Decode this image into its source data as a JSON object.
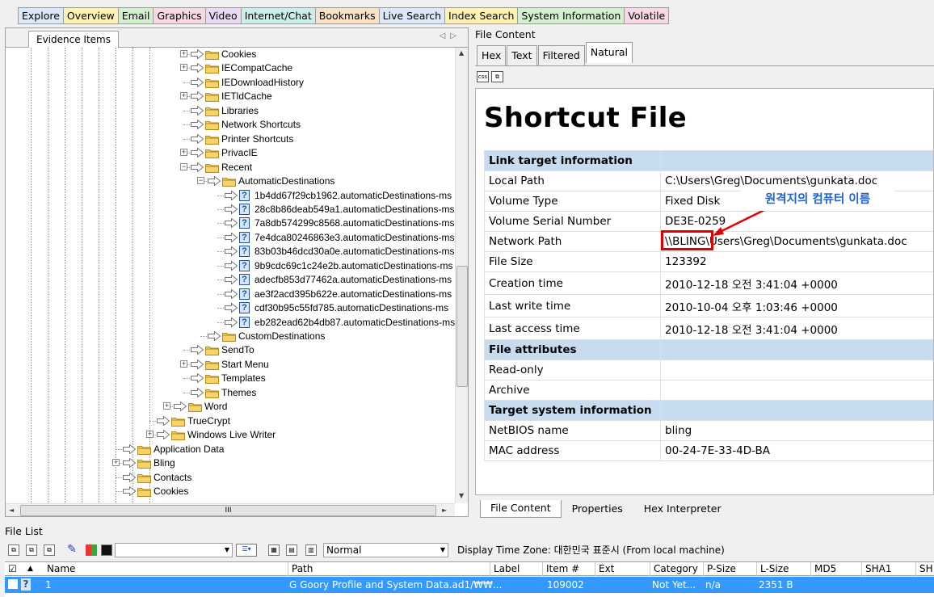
{
  "main_tabs": [
    {
      "label": "Explore",
      "bg": "#dbe8f7"
    },
    {
      "label": "Overview",
      "bg": "#fff2b3"
    },
    {
      "label": "Email",
      "bg": "#d4efd0"
    },
    {
      "label": "Graphics",
      "bg": "#f7d8e5"
    },
    {
      "label": "Video",
      "bg": "#ead9f3"
    },
    {
      "label": "Internet/Chat",
      "bg": "#cdeee8"
    },
    {
      "label": "Bookmarks",
      "bg": "#f7e1c8"
    },
    {
      "label": "Live Search",
      "bg": "#dbe8f7"
    },
    {
      "label": "Index Search",
      "bg": "#fff2b3"
    },
    {
      "label": "System Information",
      "bg": "#d4efd0"
    },
    {
      "label": "Volatile",
      "bg": "#f7d8e5"
    }
  ],
  "left_panel": {
    "tab": "Evidence Items"
  },
  "tree": [
    {
      "label": "Cookies",
      "indent": 10,
      "exp": "+",
      "kind": "folder"
    },
    {
      "label": "IECompatCache",
      "indent": 10,
      "exp": "+",
      "kind": "folder"
    },
    {
      "label": "IEDownloadHistory",
      "indent": 10,
      "exp": "",
      "kind": "folder"
    },
    {
      "label": "IETldCache",
      "indent": 10,
      "exp": "+",
      "kind": "folder"
    },
    {
      "label": "Libraries",
      "indent": 10,
      "exp": "",
      "kind": "folder"
    },
    {
      "label": "Network Shortcuts",
      "indent": 10,
      "exp": "",
      "kind": "folder"
    },
    {
      "label": "Printer Shortcuts",
      "indent": 10,
      "exp": "",
      "kind": "folder"
    },
    {
      "label": "PrivacIE",
      "indent": 10,
      "exp": "+",
      "kind": "folder"
    },
    {
      "label": "Recent",
      "indent": 10,
      "exp": "-",
      "kind": "folder"
    },
    {
      "label": "AutomaticDestinations",
      "indent": 11,
      "exp": "-",
      "kind": "folder"
    },
    {
      "label": "1b4dd67f29cb1962.automaticDestinations-ms",
      "indent": 12,
      "exp": "",
      "kind": "file"
    },
    {
      "label": "28c8b86deab549a1.automaticDestinations-ms",
      "indent": 12,
      "exp": "",
      "kind": "file"
    },
    {
      "label": "7a8db574299c8568.automaticDestinations-ms",
      "indent": 12,
      "exp": "",
      "kind": "file"
    },
    {
      "label": "7e4dca80246863e3.automaticDestinations-ms",
      "indent": 12,
      "exp": "",
      "kind": "file"
    },
    {
      "label": "83b03b46dcd30a0e.automaticDestinations-ms",
      "indent": 12,
      "exp": "",
      "kind": "file"
    },
    {
      "label": "9b9cdc69c1c24e2b.automaticDestinations-ms",
      "indent": 12,
      "exp": "",
      "kind": "file"
    },
    {
      "label": "adecfb853d77462a.automaticDestinations-ms",
      "indent": 12,
      "exp": "",
      "kind": "file"
    },
    {
      "label": "ae3f2acd395b622e.automaticDestinations-ms",
      "indent": 12,
      "exp": "",
      "kind": "file"
    },
    {
      "label": "cdf30b95c55fd785.automaticDestinations-ms",
      "indent": 12,
      "exp": "",
      "kind": "file"
    },
    {
      "label": "eb282ead62b4db87.automaticDestinations-ms",
      "indent": 12,
      "exp": "",
      "kind": "file"
    },
    {
      "label": "CustomDestinations",
      "indent": 11,
      "exp": "",
      "kind": "folder"
    },
    {
      "label": "SendTo",
      "indent": 10,
      "exp": "",
      "kind": "folder"
    },
    {
      "label": "Start Menu",
      "indent": 10,
      "exp": "+",
      "kind": "folder"
    },
    {
      "label": "Templates",
      "indent": 10,
      "exp": "",
      "kind": "folder"
    },
    {
      "label": "Themes",
      "indent": 10,
      "exp": "",
      "kind": "folder"
    },
    {
      "label": "Word",
      "indent": 9,
      "exp": "+",
      "kind": "folder"
    },
    {
      "label": "TrueCrypt",
      "indent": 8,
      "exp": "",
      "kind": "folder"
    },
    {
      "label": "Windows Live Writer",
      "indent": 8,
      "exp": "+",
      "kind": "folder"
    },
    {
      "label": "Application Data",
      "indent": 6,
      "exp": "",
      "kind": "folder"
    },
    {
      "label": "Bling",
      "indent": 6,
      "exp": "+",
      "kind": "folder"
    },
    {
      "label": "Contacts",
      "indent": 6,
      "exp": "",
      "kind": "folder"
    },
    {
      "label": "Cookies",
      "indent": 6,
      "exp": "",
      "kind": "folder"
    }
  ],
  "right_panel": {
    "title": "File Content",
    "sub_tabs": [
      "Hex",
      "Text",
      "Filtered",
      "Natural"
    ],
    "active_sub_tab": "Natural",
    "heading": "Shortcut File",
    "bottom_tabs": [
      "File Content",
      "Properties",
      "Hex Interpreter"
    ],
    "active_bottom_tab": "File Content"
  },
  "properties": [
    {
      "section": "Link target information"
    },
    {
      "k": "Local Path",
      "v": "C:\\Users\\Greg\\Documents\\gunkata.doc"
    },
    {
      "k": "Volume Type",
      "v": "Fixed Disk"
    },
    {
      "k": "Volume Serial Number",
      "v": "DE3E-0259"
    },
    {
      "k": "Network Path",
      "v": "\\\\BLING\\Users\\Greg\\Documents\\gunkata.doc"
    },
    {
      "k": "File Size",
      "v": "123392"
    },
    {
      "k": "Creation time",
      "v": "2010-12-18 오전 3:41:04 +0000",
      "tall": true
    },
    {
      "k": "Last write time",
      "v": "2010-10-04 오후 1:03:46 +0000",
      "tall": true
    },
    {
      "k": "Last access time",
      "v": "2010-12-18 오전 3:41:04 +0000",
      "tall": true
    },
    {
      "section": "File attributes"
    },
    {
      "k": "Read-only",
      "v": ""
    },
    {
      "k": "Archive",
      "v": ""
    },
    {
      "section": "Target system information"
    },
    {
      "k": "NetBIOS name",
      "v": "bling"
    },
    {
      "k": "MAC address",
      "v": "00-24-7E-33-4D-BA"
    }
  ],
  "annotation": {
    "label": "원격지의 컴퓨터 이름",
    "color": "#e00000"
  },
  "file_list": {
    "title": "File List",
    "view_mode": "Normal",
    "time_zone": "Display Time Zone: 대한민국 표준시  (From local machine)",
    "headers": [
      "Name",
      "Path",
      "Label",
      "Item #",
      "Ext",
      "Category",
      "P-Size",
      "L-Size",
      "MD5",
      "SHA1",
      "SH"
    ],
    "row": {
      "name": "1",
      "path": "G Goory Profile and System Data.ad1/₩₩...",
      "label": "",
      "item": "109002",
      "ext": "",
      "category": "Not Yet...",
      "psize": "n/a",
      "lsize": "2351 B"
    }
  }
}
